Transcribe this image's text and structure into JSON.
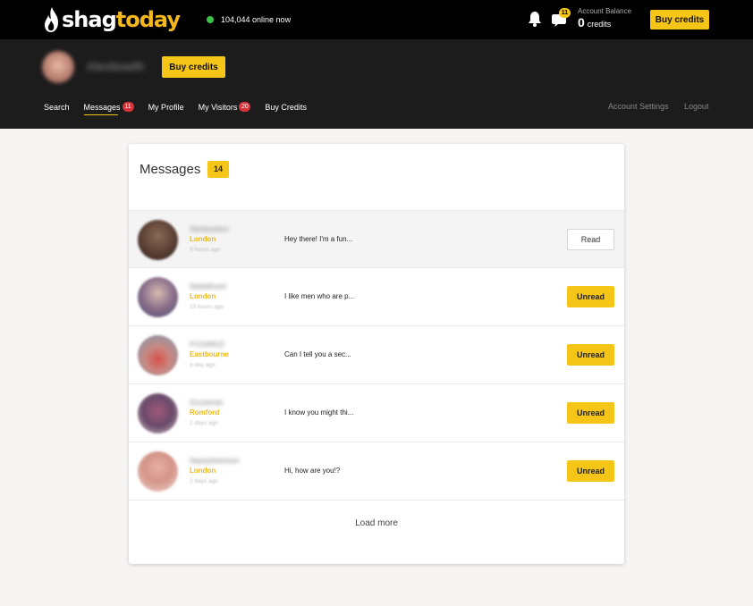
{
  "brand": {
    "part1": "shag",
    "part2": "today"
  },
  "header": {
    "online_text": "104,044 online now",
    "chat_badge": "11",
    "balance_label": "Account Balance",
    "balance_amount": "0",
    "balance_unit": "credits",
    "buy_label": "Buy credits"
  },
  "profile": {
    "name": "Alexbowth",
    "buy_label": "Buy credits"
  },
  "nav": {
    "items": [
      {
        "label": "Search",
        "badge": ""
      },
      {
        "label": "Messages",
        "badge": "11"
      },
      {
        "label": "My Profile",
        "badge": ""
      },
      {
        "label": "My Visitors",
        "badge": "20"
      },
      {
        "label": "Buy Credits",
        "badge": ""
      }
    ],
    "account_settings": "Account Settings",
    "logout": "Logout"
  },
  "messages": {
    "title": "Messages",
    "count": "14",
    "load_more": "Load more",
    "rows": [
      {
        "name": "Santieurtere",
        "city": "London",
        "ago": "9 hours ago",
        "preview": "Hey there! I'm a fun...",
        "status": "Read"
      },
      {
        "name": "Nadiathuert",
        "city": "London",
        "ago": "15 hours ago",
        "preview": "I like men who are p...",
        "status": "Unread"
      },
      {
        "name": "P.CHARLE",
        "city": "Eastbourne",
        "ago": "a day ago",
        "preview": "Can I tell you a sec...",
        "status": "Unread"
      },
      {
        "name": "Gruvannie",
        "city": "Romford",
        "ago": "2 days ago",
        "preview": "I know you might thi...",
        "status": "Unread"
      },
      {
        "name": "Naasylintenture",
        "city": "London",
        "ago": "2 days ago",
        "preview": "Hi, how are you!?",
        "status": "Unread"
      }
    ]
  },
  "colors": {
    "accent": "#f5c518",
    "badge_red": "#d9333a",
    "online_green": "#3bc34a"
  }
}
